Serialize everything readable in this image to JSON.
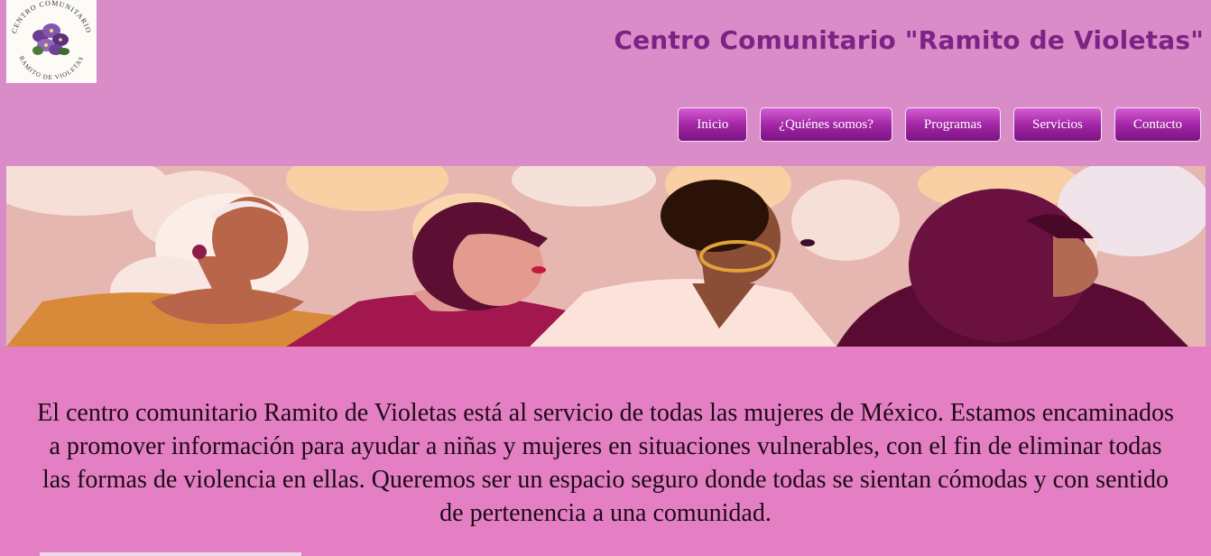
{
  "logo": {
    "top_text": "CENTRO COMUNITARIO",
    "bottom_text": "RAMITO DE VIOLETAS",
    "icon": "violet-flowers-icon"
  },
  "header": {
    "title": "Centro Comunitario \"Ramito de Violetas\""
  },
  "nav": {
    "items": [
      {
        "label": "Inicio"
      },
      {
        "label": "¿Quiénes somos?"
      },
      {
        "label": "Programas"
      },
      {
        "label": "Servicios"
      },
      {
        "label": "Contacto"
      }
    ]
  },
  "hero": {
    "image": "illustration-four-women"
  },
  "main": {
    "intro": "El centro comunitario Ramito de Violetas está al servicio de todas las mujeres de México. Estamos encaminados a promover información para ayudar a niñas y mujeres en situaciones vulnerables, con el fin de eliminar todas las formas de violencia en ellas. Queremos ser un espacio seguro donde todas se sientan cómodas y con sentido de pertenencia a una comunidad."
  },
  "colors": {
    "header_bg": "#da8cc8",
    "main_bg": "#e47fc3",
    "title": "#7e2285",
    "button_top": "#d45ed0",
    "button_bottom": "#7c1483"
  }
}
